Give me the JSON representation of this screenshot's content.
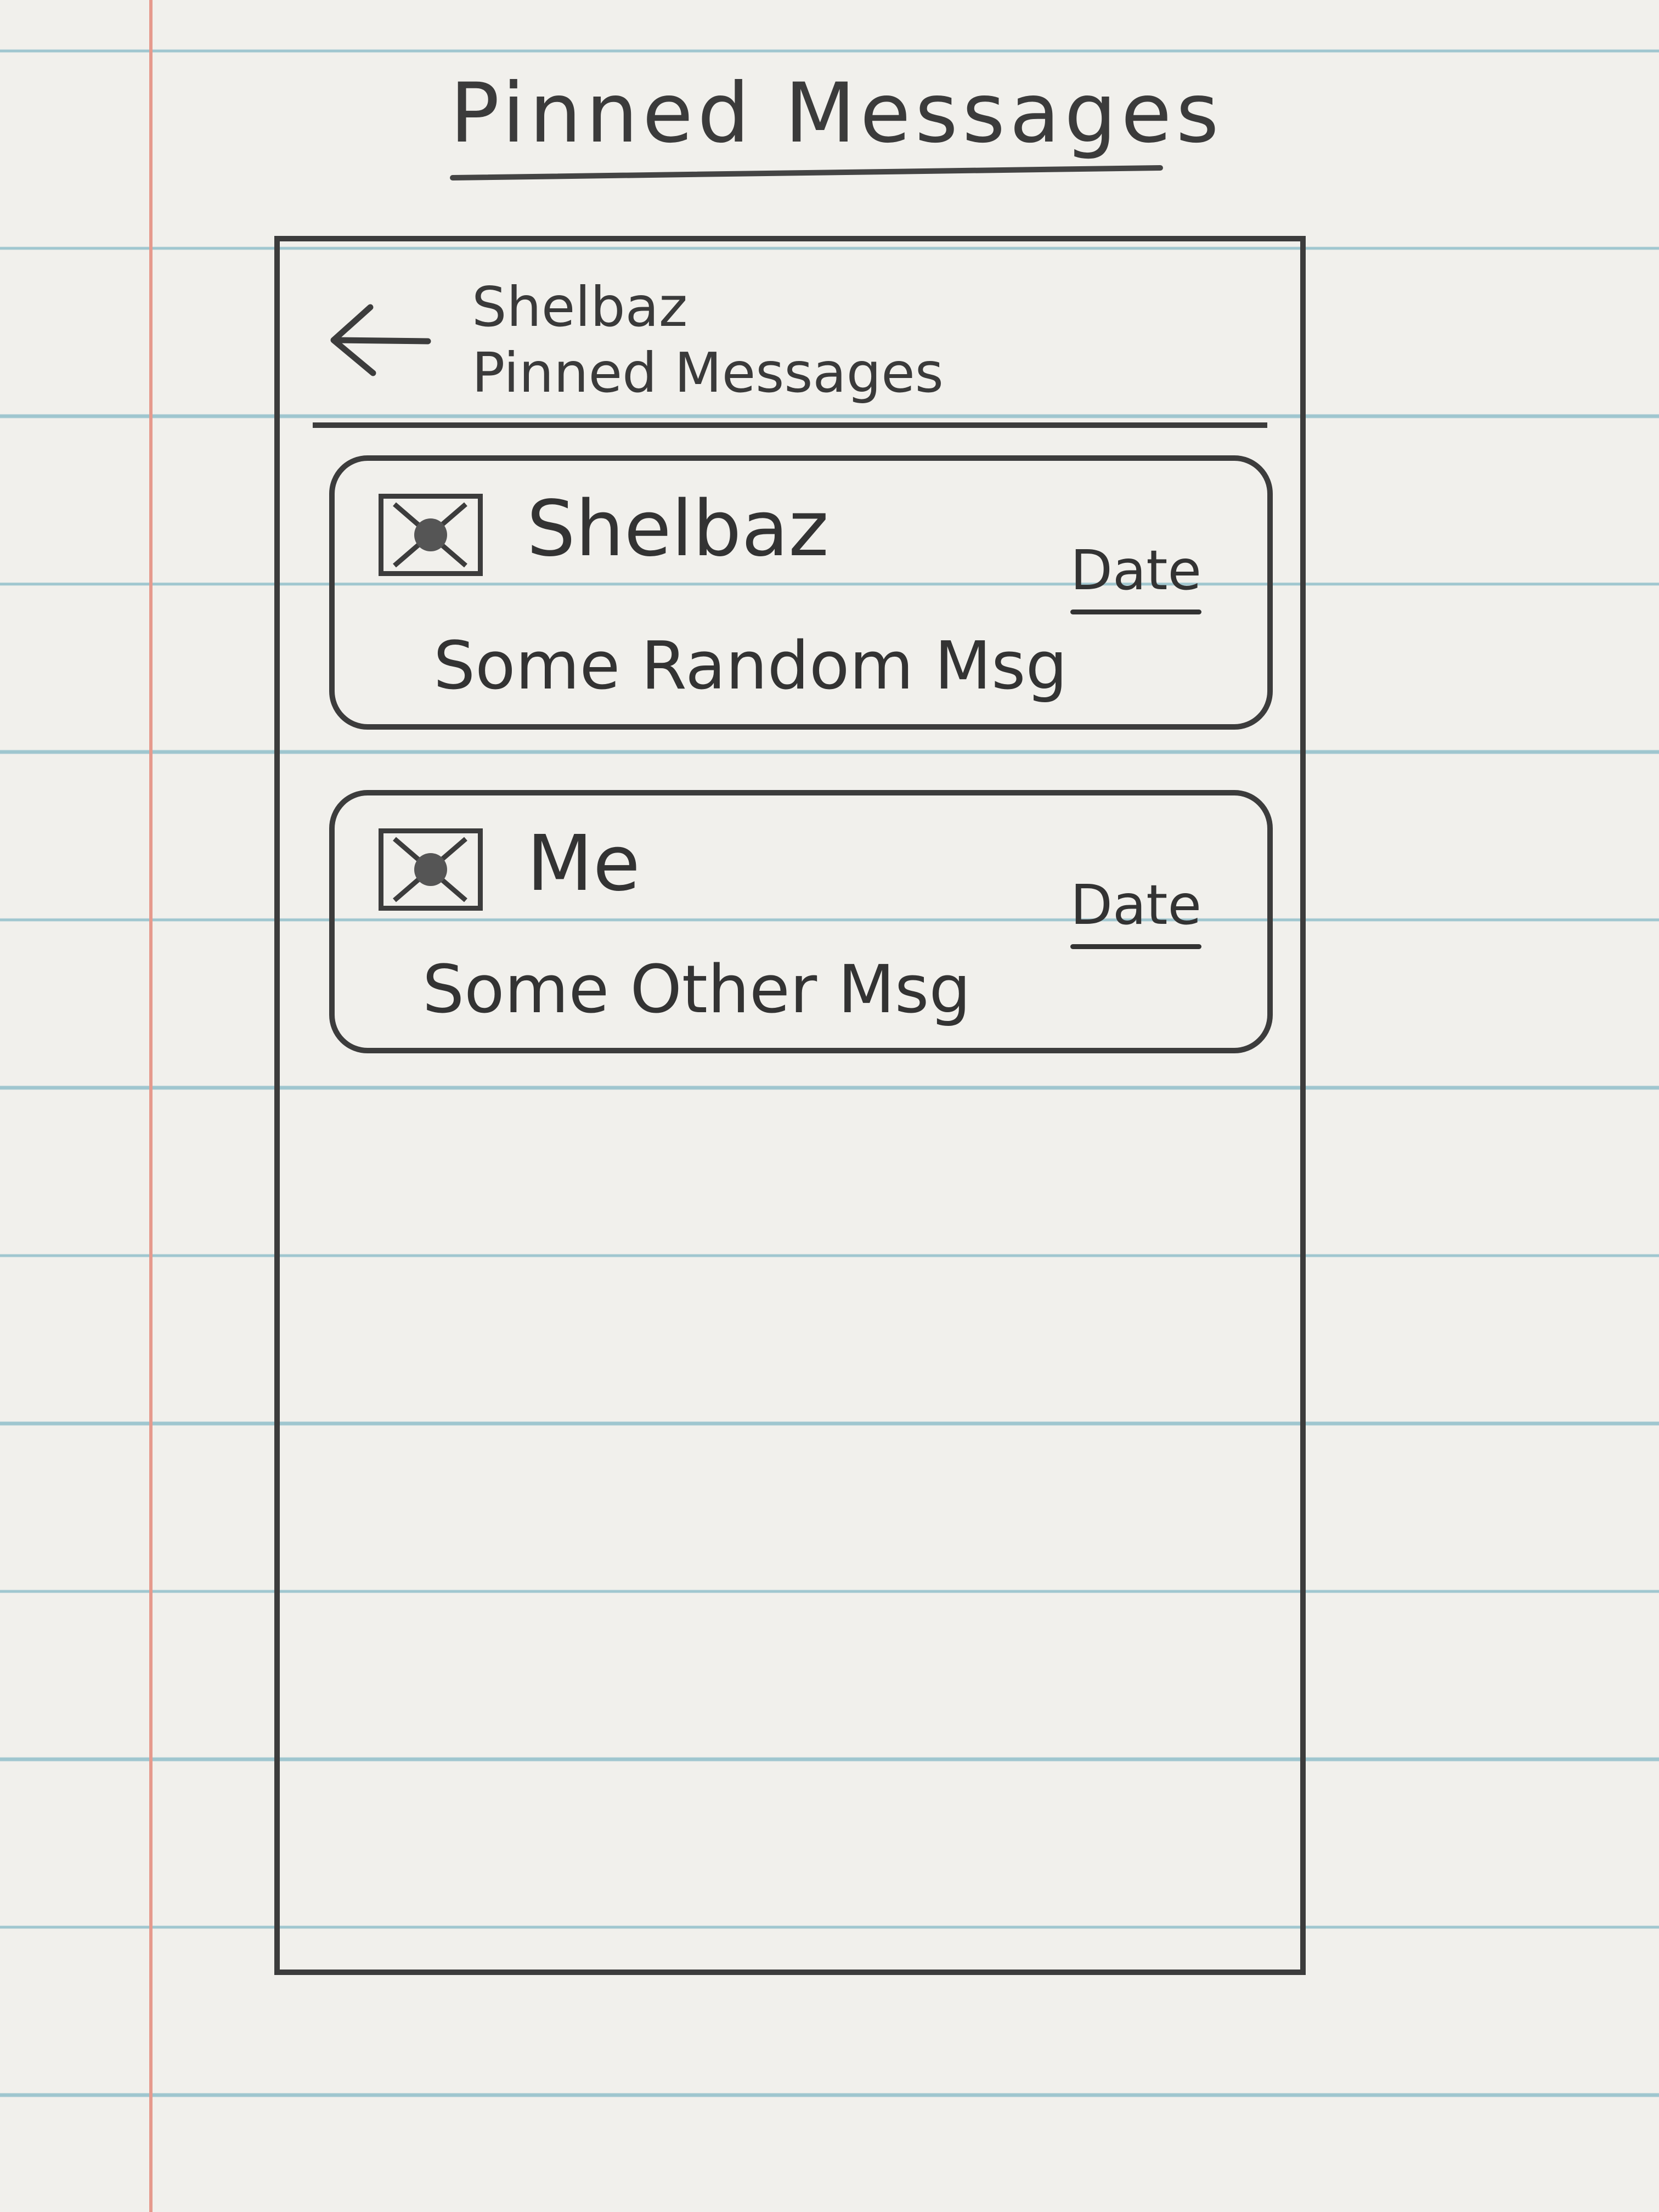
{
  "sheet_title": "Pinned Messages",
  "header": {
    "name": "Shelbaz",
    "subtitle": "Pinned Messages",
    "back_icon": "left-arrow-icon"
  },
  "messages": [
    {
      "sender": "Shelbaz",
      "date": "Date",
      "text": "Some Random Msg",
      "avatar_icon": "image-placeholder-icon"
    },
    {
      "sender": "Me",
      "date": "Date",
      "text": "Some Other Msg",
      "avatar_icon": "image-placeholder-icon"
    }
  ],
  "colors": {
    "paper": "#f1f0ec",
    "rule_line": "#9fc6cf",
    "margin_line": "#e69a8d",
    "pencil": "#3c3c3c"
  }
}
